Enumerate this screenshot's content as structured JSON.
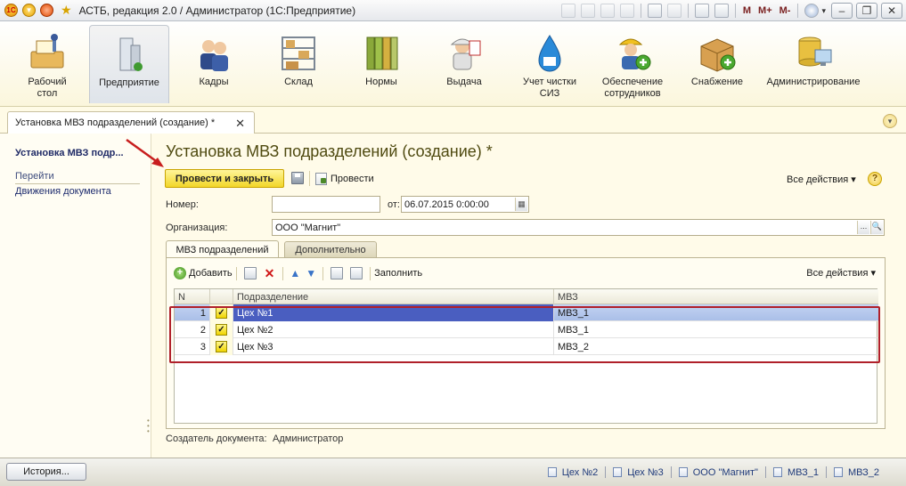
{
  "window": {
    "title": "АСТБ, редакция 2.0 / Администратор  (1С:Предприятие)",
    "toolbar_m": [
      "M",
      "M+",
      "M-"
    ],
    "help": "i"
  },
  "sections": [
    {
      "label": "Рабочий стол",
      "icon": "desktop-icon"
    },
    {
      "label": "Предприятие",
      "icon": "enterprise-icon"
    },
    {
      "label": "Кадры",
      "icon": "staff-icon"
    },
    {
      "label": "Склад",
      "icon": "warehouse-icon"
    },
    {
      "label": "Нормы",
      "icon": "norms-icon"
    },
    {
      "label": "Выдача",
      "icon": "issue-icon"
    },
    {
      "label": "Учет чистки СИЗ",
      "icon": "cleaning-icon"
    },
    {
      "label": "Обеспечение сотрудников",
      "icon": "provision-icon"
    },
    {
      "label": "Снабжение",
      "icon": "supply-icon"
    },
    {
      "label": "Администрирование",
      "icon": "admin-icon"
    }
  ],
  "open_tab": {
    "label": "Установка МВЗ подразделений (создание) *",
    "close": "✕"
  },
  "left_nav": {
    "title": "Установка МВЗ подр...",
    "section": "Перейти",
    "link": "Движения документа"
  },
  "form": {
    "title": "Установка МВЗ подразделений (создание) *",
    "post_close_label": "Провести и закрыть",
    "post_label": "Провести",
    "all_actions": "Все действия ▾",
    "number_label": "Номер:",
    "number_value": "",
    "date_label": "от:",
    "date_value": "06.07.2015  0:00:00",
    "org_label": "Организация:",
    "org_value": "ООО \"Магнит\"",
    "creator_label": "Создатель документа:",
    "creator_value": "Администратор"
  },
  "inner_tabs": [
    "МВЗ подразделений",
    "Дополнительно"
  ],
  "table_toolbar": {
    "add_label": "Добавить",
    "fill_label": "Заполнить",
    "all_actions": "Все действия ▾"
  },
  "table": {
    "columns": [
      "N",
      "",
      "Подразделение",
      "МВЗ"
    ],
    "rows": [
      {
        "n": "1",
        "checked": true,
        "division": "Цех №1",
        "mvz": "МВЗ_1"
      },
      {
        "n": "2",
        "checked": true,
        "division": "Цех №2",
        "mvz": "МВЗ_1"
      },
      {
        "n": "3",
        "checked": true,
        "division": "Цех №3",
        "mvz": "МВЗ_2"
      }
    ]
  },
  "statusbar": {
    "history": "История...",
    "items": [
      "Цех №2",
      "Цех №3",
      "ООО \"Магнит\"",
      "МВЗ_1",
      "МВЗ_2"
    ]
  },
  "colors": {
    "accent_yellow": "#f2d628",
    "selection_blue": "#4a5ec0",
    "frame_red": "#b0202a",
    "title_olive": "#4f4a10"
  }
}
